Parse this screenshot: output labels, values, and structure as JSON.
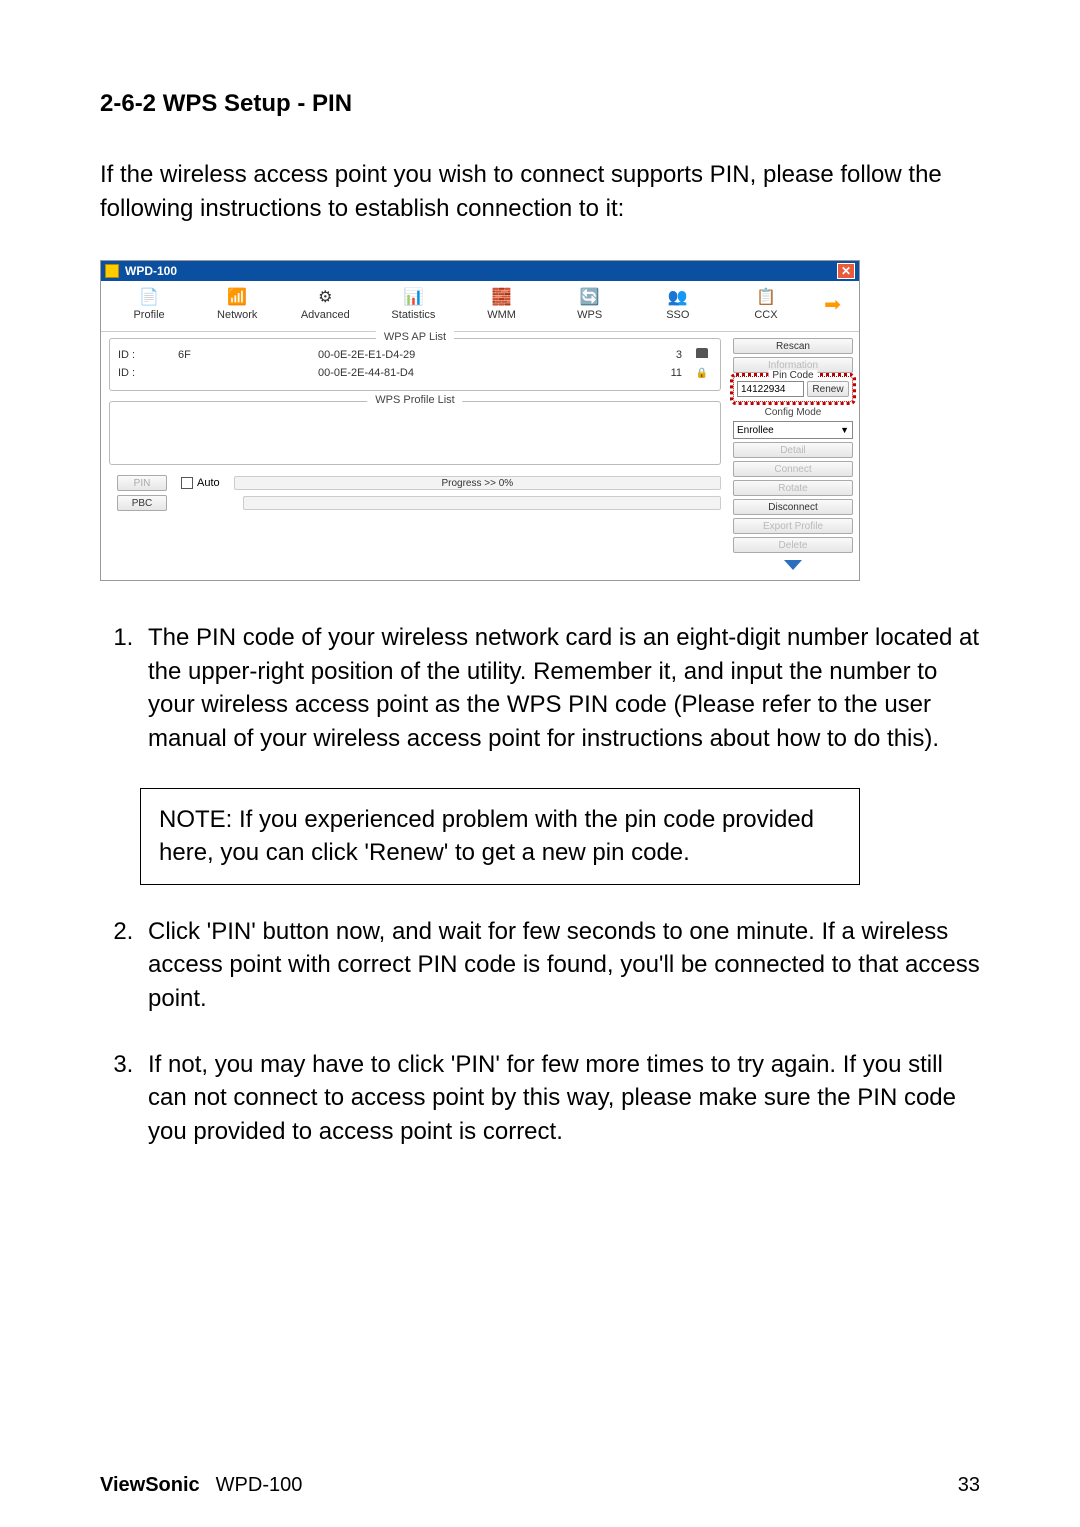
{
  "section_number": "2-6-2 WPS Setup - PIN",
  "intro": "If the wireless access point you wish to connect supports PIN, please follow the following instructions to establish connection to it:",
  "window": {
    "title": "WPD-100",
    "tabs": {
      "profile": "Profile",
      "network": "Network",
      "advanced": "Advanced",
      "statistics": "Statistics",
      "wmm": "WMM",
      "wps": "WPS",
      "sso": "SSO",
      "ccx": "CCX"
    },
    "ap_list": {
      "legend": "WPS AP List",
      "rows": [
        {
          "id": "ID :",
          "name": "6F",
          "mac": "00-0E-2E-E1-D4-29",
          "ch": "3"
        },
        {
          "id": "ID :",
          "name": "",
          "mac": "00-0E-2E-44-81-D4",
          "ch": "11"
        }
      ]
    },
    "profile_list": {
      "legend": "WPS Profile List"
    },
    "controls": {
      "pin": "PIN",
      "pbc": "PBC",
      "auto": "Auto",
      "progress": "Progress >> 0%"
    },
    "side": {
      "rescan": "Rescan",
      "information": "Information",
      "pin_legend": "Pin Code",
      "pin_value": "14122934",
      "renew": "Renew",
      "config_mode": "Config Mode",
      "mode_value": "Enrollee",
      "detail": "Detail",
      "connect": "Connect",
      "rotate": "Rotate",
      "disconnect": "Disconnect",
      "export": "Export Profile",
      "delete": "Delete"
    }
  },
  "steps": {
    "s1": "The PIN code of your wireless network card is an eight-digit number located at the upper-right position of the utility. Remember it, and input the number to your wireless access point as the WPS PIN code (Please refer to the user manual of your wireless access point for instructions about how to do this).",
    "note": "NOTE: If you experienced problem with the pin code provided here, you can click 'Renew' to get a new pin code.",
    "s2": "Click 'PIN' button now, and wait for few seconds to one minute. If a wireless access point with correct PIN code is found, you'll be connected to that access point.",
    "s3": "If not, you may have to click 'PIN' for few more times to try again. If you still can not connect to access point by this way, please make sure the PIN code you provided to access point is correct."
  },
  "footer": {
    "brand": "ViewSonic",
    "model": "WPD-100",
    "page": "33"
  }
}
